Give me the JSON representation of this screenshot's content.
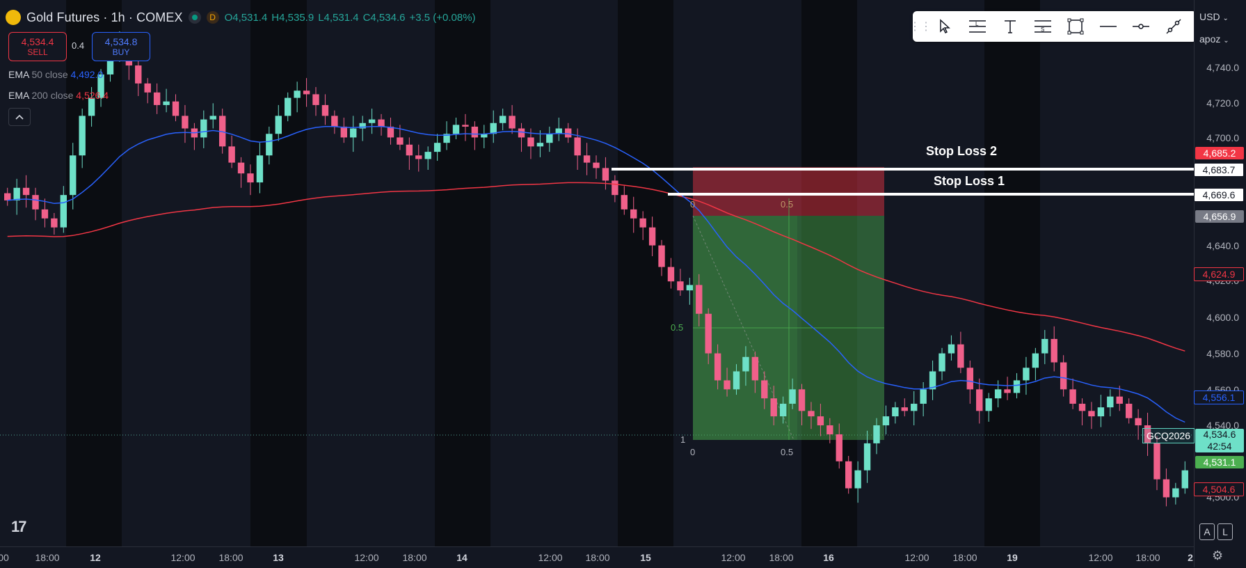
{
  "header": {
    "title": "Gold Futures · 1h · COMEX",
    "status_badge": "D",
    "ohlc": {
      "open": "O4,531.4",
      "high": "H4,535.9",
      "low": "L4,531.4",
      "close": "C4,534.6",
      "change": "+3.5 (+0.08%)"
    }
  },
  "trade_buttons": {
    "sell_price": "4,534.4",
    "sell_label": "SELL",
    "spread": "0.4",
    "buy_price": "4,534.8",
    "buy_label": "BUY"
  },
  "indicators": {
    "ema50": {
      "name": "EMA",
      "params": "50 close",
      "value": "4,492.0"
    },
    "ema200": {
      "name": "EMA",
      "params": "200 close",
      "value": "4,526.4"
    }
  },
  "toolbar": {
    "icons": [
      "drag-handle-icon",
      "cursor-icon",
      "long-position-icon",
      "text-icon",
      "short-position-icon",
      "rectangle-icon",
      "horizontal-line-icon",
      "horizontal-ray-icon",
      "trend-line-icon"
    ]
  },
  "scale": {
    "currency": "USD",
    "account": "apoz",
    "ticks": [
      "4,740.0",
      "4,720.0",
      "4,700.0",
      "4,640.0",
      "4,620.0",
      "4,600.0",
      "4,580.0",
      "4,560.0",
      "4,540.0",
      "4,500.0"
    ],
    "labels": {
      "stop2": "4,685.2",
      "sl2_line": "4,683.7",
      "sl1_line": "4,669.6",
      "entry": "4,656.9",
      "ema200": "4,624.9",
      "ema50": "4,556.1",
      "last": "4,534.6",
      "countdown": "42:54",
      "target": "4,531.1",
      "low": "4,504.6"
    },
    "symbol_tag": "GCQ2026"
  },
  "annotations": {
    "stop_loss_2": "Stop Loss 2",
    "stop_loss_1": "Stop Loss 1",
    "fib_0": "0",
    "fib_05": "0.5",
    "fib_1": "1"
  },
  "time_axis": [
    "00",
    "18:00",
    "12",
    "12:00",
    "18:00",
    "13",
    "12:00",
    "18:00",
    "14",
    "12:00",
    "18:00",
    "15",
    "12:00",
    "18:00",
    "16",
    "12:00",
    "18:00",
    "19",
    "12:00",
    "18:00",
    "2"
  ],
  "bottom_buttons": {
    "auto": "A",
    "log": "L"
  },
  "colors": {
    "background": "#131722",
    "up": "#6ee0c8",
    "down": "#f0608a",
    "ema50": "#2962ff",
    "ema200": "#f23645",
    "stop_zone": "#f23645",
    "profit_zone": "#4caf50"
  }
}
